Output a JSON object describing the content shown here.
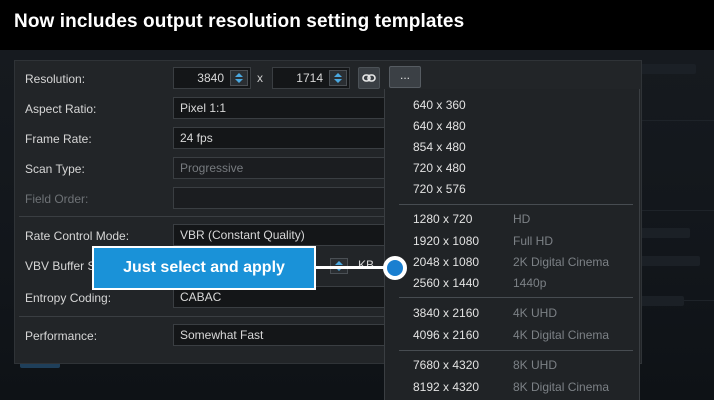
{
  "headline": "Now includes output resolution setting templates",
  "settings": {
    "resolution": {
      "label": "Resolution:",
      "width": "3840",
      "height": "1714",
      "separator": "x",
      "more_label": "..."
    },
    "aspect_ratio": {
      "label": "Aspect Ratio:",
      "value": "Pixel 1:1"
    },
    "frame_rate": {
      "label": "Frame Rate:",
      "value": "24 fps"
    },
    "scan_type": {
      "label": "Scan Type:",
      "value": "Progressive"
    },
    "field_order": {
      "label": "Field Order:",
      "value": ""
    },
    "rate_control_mode": {
      "label": "Rate Control Mode:",
      "value": "VBR (Constant Quality)"
    },
    "vbv_buffer": {
      "label": "VBV Buffer S",
      "unit": "KB"
    },
    "entropy_coding": {
      "label": "Entropy Coding:",
      "value": "CABAC"
    },
    "performance": {
      "label": "Performance:",
      "value": "Somewhat Fast"
    }
  },
  "templates": {
    "group1": [
      {
        "res": "640 x 360"
      },
      {
        "res": "640 x 480"
      },
      {
        "res": "854 x 480"
      },
      {
        "res": "720 x 480"
      },
      {
        "res": "720 x 576"
      }
    ],
    "group2": [
      {
        "res": "1280 x 720",
        "name": "HD"
      },
      {
        "res": "1920 x 1080",
        "name": "Full HD"
      },
      {
        "res": "2048 x 1080",
        "name": "2K Digital Cinema"
      },
      {
        "res": "2560 x 1440",
        "name": "1440p"
      }
    ],
    "group3": [
      {
        "res": "3840 x 2160",
        "name": "4K UHD"
      },
      {
        "res": "4096 x 2160",
        "name": "4K Digital Cinema"
      }
    ],
    "group4": [
      {
        "res": "7680 x 4320",
        "name": "8K UHD"
      },
      {
        "res": "8192 x 4320",
        "name": "8K Digital Cinema"
      }
    ]
  },
  "callout": "Just select and apply",
  "colors": {
    "accent": "#1a92d8",
    "panel": "#222528",
    "spinner_arrow": "#4aa8e0"
  },
  "icons": {
    "link": "link-icon",
    "spin": "spinner-arrows-icon"
  }
}
